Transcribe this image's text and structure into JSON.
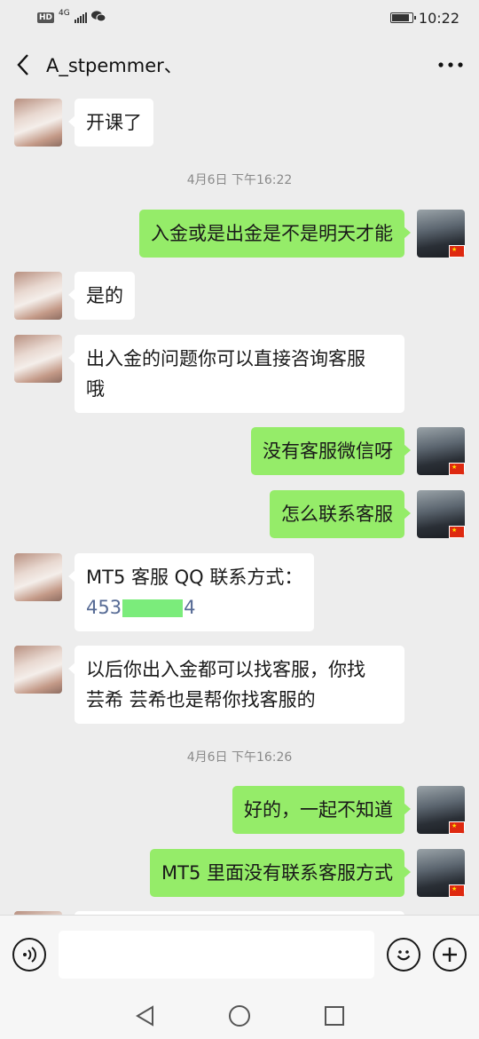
{
  "status_bar": {
    "hd": "HD",
    "network": "4G",
    "time": "10:22"
  },
  "header": {
    "title": "A_stpemmer、"
  },
  "timestamps": [
    "4月6日 下午16:22",
    "4月6日 下午16:26"
  ],
  "messages": [
    {
      "side": "left",
      "text": "开课了"
    },
    {
      "side": "right",
      "text": "入金或是出金是不是明天才能"
    },
    {
      "side": "left",
      "text": "是的"
    },
    {
      "side": "left",
      "line1": "出入金的问题你可以直接咨询客服",
      "line2": "哦"
    },
    {
      "side": "right",
      "text": "没有客服微信呀"
    },
    {
      "side": "right",
      "text": "怎么联系客服"
    },
    {
      "side": "left",
      "line1": "MT5 客服 QQ 联系方式：",
      "qq_prefix": "453",
      "qq_suffix": "4"
    },
    {
      "side": "left",
      "line1": "以后你出入金都可以找客服，你找",
      "line2": "芸希 芸希也是帮你找客服的"
    },
    {
      "side": "right",
      "text": "好的，一起不知道"
    },
    {
      "side": "right",
      "text": "MT5 里面没有联系客服方式"
    }
  ],
  "icons": {
    "back": "chevron-left-icon",
    "more": "more-dots-icon",
    "voice": "voice-icon",
    "emoji": "emoji-icon",
    "plus": "plus-icon",
    "nav_back": "triangle-back-icon",
    "nav_home": "circle-home-icon",
    "nav_recent": "square-recent-icon"
  },
  "colors": {
    "background": "#ededed",
    "bubble_self": "#95ec69",
    "bubble_other": "#ffffff",
    "link": "#576b95"
  }
}
